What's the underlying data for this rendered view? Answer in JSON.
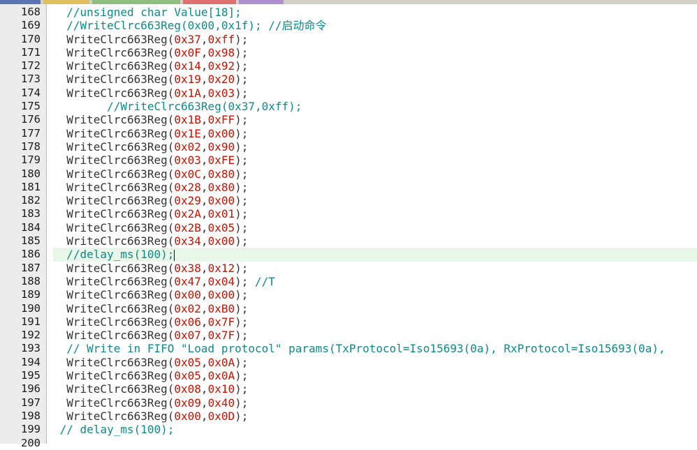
{
  "editor": {
    "tabs": [
      {
        "color": "#5b74b5"
      },
      {
        "color": "#e0c060"
      },
      {
        "color": "#8fbf7f"
      },
      {
        "color": "#e07070"
      },
      {
        "color": "#b090d0"
      }
    ],
    "current_line": 186,
    "lines": [
      {
        "num": "168",
        "indent": "  ",
        "segments": [
          {
            "t": "cmt",
            "v": "//unsigned char Value[18];"
          }
        ]
      },
      {
        "num": "169",
        "indent": "  ",
        "segments": [
          {
            "t": "cmt",
            "v": "//WriteClrc663Reg(0x00,0x1f); //启动命令"
          }
        ]
      },
      {
        "num": "170",
        "indent": "  ",
        "segments": [
          {
            "t": "fn",
            "v": "WriteClrc663Reg("
          },
          {
            "t": "hex",
            "v": "0x37"
          },
          {
            "t": "punc",
            "v": ","
          },
          {
            "t": "hex",
            "v": "0xff"
          },
          {
            "t": "punc",
            "v": ");"
          }
        ]
      },
      {
        "num": "171",
        "indent": "  ",
        "segments": [
          {
            "t": "fn",
            "v": "WriteClrc663Reg("
          },
          {
            "t": "hex",
            "v": "0x0F"
          },
          {
            "t": "punc",
            "v": ","
          },
          {
            "t": "hex",
            "v": "0x98"
          },
          {
            "t": "punc",
            "v": ");"
          }
        ]
      },
      {
        "num": "172",
        "indent": "  ",
        "segments": [
          {
            "t": "fn",
            "v": "WriteClrc663Reg("
          },
          {
            "t": "hex",
            "v": "0x14"
          },
          {
            "t": "punc",
            "v": ","
          },
          {
            "t": "hex",
            "v": "0x92"
          },
          {
            "t": "punc",
            "v": ");"
          }
        ]
      },
      {
        "num": "173",
        "indent": "  ",
        "segments": [
          {
            "t": "fn",
            "v": "WriteClrc663Reg("
          },
          {
            "t": "hex",
            "v": "0x19"
          },
          {
            "t": "punc",
            "v": ","
          },
          {
            "t": "hex",
            "v": "0x20"
          },
          {
            "t": "punc",
            "v": ");"
          }
        ]
      },
      {
        "num": "174",
        "indent": "  ",
        "segments": [
          {
            "t": "fn",
            "v": "WriteClrc663Reg("
          },
          {
            "t": "hex",
            "v": "0x1A"
          },
          {
            "t": "punc",
            "v": ","
          },
          {
            "t": "hex",
            "v": "0x03"
          },
          {
            "t": "punc",
            "v": ");"
          }
        ]
      },
      {
        "num": "175",
        "indent": "        ",
        "segments": [
          {
            "t": "cmt",
            "v": "//WriteClrc663Reg(0x37,0xff);"
          }
        ]
      },
      {
        "num": "176",
        "indent": "  ",
        "segments": [
          {
            "t": "fn",
            "v": "WriteClrc663Reg("
          },
          {
            "t": "hex",
            "v": "0x1B"
          },
          {
            "t": "punc",
            "v": ","
          },
          {
            "t": "hex",
            "v": "0xFF"
          },
          {
            "t": "punc",
            "v": ");"
          }
        ]
      },
      {
        "num": "177",
        "indent": "  ",
        "segments": [
          {
            "t": "fn",
            "v": "WriteClrc663Reg("
          },
          {
            "t": "hex",
            "v": "0x1E"
          },
          {
            "t": "punc",
            "v": ","
          },
          {
            "t": "hex",
            "v": "0x00"
          },
          {
            "t": "punc",
            "v": ");"
          }
        ]
      },
      {
        "num": "178",
        "indent": "  ",
        "segments": [
          {
            "t": "fn",
            "v": "WriteClrc663Reg("
          },
          {
            "t": "hex",
            "v": "0x02"
          },
          {
            "t": "punc",
            "v": ","
          },
          {
            "t": "hex",
            "v": "0x90"
          },
          {
            "t": "punc",
            "v": ");"
          }
        ]
      },
      {
        "num": "179",
        "indent": "  ",
        "segments": [
          {
            "t": "fn",
            "v": "WriteClrc663Reg("
          },
          {
            "t": "hex",
            "v": "0x03"
          },
          {
            "t": "punc",
            "v": ","
          },
          {
            "t": "hex",
            "v": "0xFE"
          },
          {
            "t": "punc",
            "v": ");"
          }
        ]
      },
      {
        "num": "180",
        "indent": "  ",
        "segments": [
          {
            "t": "fn",
            "v": "WriteClrc663Reg("
          },
          {
            "t": "hex",
            "v": "0x0C"
          },
          {
            "t": "punc",
            "v": ","
          },
          {
            "t": "hex",
            "v": "0x80"
          },
          {
            "t": "punc",
            "v": ");"
          }
        ]
      },
      {
        "num": "181",
        "indent": "  ",
        "segments": [
          {
            "t": "fn",
            "v": "WriteClrc663Reg("
          },
          {
            "t": "hex",
            "v": "0x28"
          },
          {
            "t": "punc",
            "v": ","
          },
          {
            "t": "hex",
            "v": "0x80"
          },
          {
            "t": "punc",
            "v": ");"
          }
        ]
      },
      {
        "num": "182",
        "indent": "  ",
        "segments": [
          {
            "t": "fn",
            "v": "WriteClrc663Reg("
          },
          {
            "t": "hex",
            "v": "0x29"
          },
          {
            "t": "punc",
            "v": ","
          },
          {
            "t": "hex",
            "v": "0x00"
          },
          {
            "t": "punc",
            "v": ");"
          }
        ]
      },
      {
        "num": "183",
        "indent": "  ",
        "segments": [
          {
            "t": "fn",
            "v": "WriteClrc663Reg("
          },
          {
            "t": "hex",
            "v": "0x2A"
          },
          {
            "t": "punc",
            "v": ","
          },
          {
            "t": "hex",
            "v": "0x01"
          },
          {
            "t": "punc",
            "v": ");"
          }
        ]
      },
      {
        "num": "184",
        "indent": "  ",
        "segments": [
          {
            "t": "fn",
            "v": "WriteClrc663Reg("
          },
          {
            "t": "hex",
            "v": "0x2B"
          },
          {
            "t": "punc",
            "v": ","
          },
          {
            "t": "hex",
            "v": "0x05"
          },
          {
            "t": "punc",
            "v": ");"
          }
        ]
      },
      {
        "num": "185",
        "indent": "  ",
        "segments": [
          {
            "t": "fn",
            "v": "WriteClrc663Reg("
          },
          {
            "t": "hex",
            "v": "0x34"
          },
          {
            "t": "punc",
            "v": ","
          },
          {
            "t": "hex",
            "v": "0x00"
          },
          {
            "t": "punc",
            "v": ");"
          }
        ]
      },
      {
        "num": "186",
        "indent": "  ",
        "segments": [
          {
            "t": "cmt",
            "v": "//delay_ms(100);"
          }
        ],
        "caret": true
      },
      {
        "num": "187",
        "indent": "  ",
        "segments": [
          {
            "t": "fn",
            "v": "WriteClrc663Reg("
          },
          {
            "t": "hex",
            "v": "0x38"
          },
          {
            "t": "punc",
            "v": ","
          },
          {
            "t": "hex",
            "v": "0x12"
          },
          {
            "t": "punc",
            "v": ");"
          }
        ]
      },
      {
        "num": "188",
        "indent": "  ",
        "segments": [
          {
            "t": "fn",
            "v": "WriteClrc663Reg("
          },
          {
            "t": "hex",
            "v": "0x47"
          },
          {
            "t": "punc",
            "v": ","
          },
          {
            "t": "hex",
            "v": "0x04"
          },
          {
            "t": "punc",
            "v": "); "
          },
          {
            "t": "cmt",
            "v": "//T"
          }
        ]
      },
      {
        "num": "189",
        "indent": "  ",
        "segments": [
          {
            "t": "fn",
            "v": "WriteClrc663Reg("
          },
          {
            "t": "hex",
            "v": "0x00"
          },
          {
            "t": "punc",
            "v": ","
          },
          {
            "t": "hex",
            "v": "0x00"
          },
          {
            "t": "punc",
            "v": ");"
          }
        ]
      },
      {
        "num": "190",
        "indent": "  ",
        "segments": [
          {
            "t": "fn",
            "v": "WriteClrc663Reg("
          },
          {
            "t": "hex",
            "v": "0x02"
          },
          {
            "t": "punc",
            "v": ","
          },
          {
            "t": "hex",
            "v": "0xB0"
          },
          {
            "t": "punc",
            "v": ");"
          }
        ]
      },
      {
        "num": "191",
        "indent": "  ",
        "segments": [
          {
            "t": "fn",
            "v": "WriteClrc663Reg("
          },
          {
            "t": "hex",
            "v": "0x06"
          },
          {
            "t": "punc",
            "v": ","
          },
          {
            "t": "hex",
            "v": "0x7F"
          },
          {
            "t": "punc",
            "v": ");"
          }
        ]
      },
      {
        "num": "192",
        "indent": "  ",
        "segments": [
          {
            "t": "fn",
            "v": "WriteClrc663Reg("
          },
          {
            "t": "hex",
            "v": "0x07"
          },
          {
            "t": "punc",
            "v": ","
          },
          {
            "t": "hex",
            "v": "0x7F"
          },
          {
            "t": "punc",
            "v": ");"
          }
        ]
      },
      {
        "num": "193",
        "indent": "  ",
        "segments": [
          {
            "t": "cmt",
            "v": "// Write in FIFO \"Load protocol\" params(TxProtocol=Iso15693(0a), RxProtocol=Iso15693(0a),"
          }
        ]
      },
      {
        "num": "194",
        "indent": "  ",
        "segments": [
          {
            "t": "fn",
            "v": "WriteClrc663Reg("
          },
          {
            "t": "hex",
            "v": "0x05"
          },
          {
            "t": "punc",
            "v": ","
          },
          {
            "t": "hex",
            "v": "0x0A"
          },
          {
            "t": "punc",
            "v": ");"
          }
        ]
      },
      {
        "num": "195",
        "indent": "  ",
        "segments": [
          {
            "t": "fn",
            "v": "WriteClrc663Reg("
          },
          {
            "t": "hex",
            "v": "0x05"
          },
          {
            "t": "punc",
            "v": ","
          },
          {
            "t": "hex",
            "v": "0x0A"
          },
          {
            "t": "punc",
            "v": ");"
          }
        ]
      },
      {
        "num": "196",
        "indent": "  ",
        "segments": [
          {
            "t": "fn",
            "v": "WriteClrc663Reg("
          },
          {
            "t": "hex",
            "v": "0x08"
          },
          {
            "t": "punc",
            "v": ","
          },
          {
            "t": "hex",
            "v": "0x10"
          },
          {
            "t": "punc",
            "v": ");"
          }
        ]
      },
      {
        "num": "197",
        "indent": "  ",
        "segments": [
          {
            "t": "fn",
            "v": "WriteClrc663Reg("
          },
          {
            "t": "hex",
            "v": "0x09"
          },
          {
            "t": "punc",
            "v": ","
          },
          {
            "t": "hex",
            "v": "0x40"
          },
          {
            "t": "punc",
            "v": ");"
          }
        ]
      },
      {
        "num": "198",
        "indent": "  ",
        "segments": [
          {
            "t": "fn",
            "v": "WriteClrc663Reg("
          },
          {
            "t": "hex",
            "v": "0x00"
          },
          {
            "t": "punc",
            "v": ","
          },
          {
            "t": "hex",
            "v": "0x0D"
          },
          {
            "t": "punc",
            "v": ");"
          }
        ]
      },
      {
        "num": "199",
        "indent": " ",
        "segments": [
          {
            "t": "cmt",
            "v": "// delay_ms(100);"
          }
        ]
      },
      {
        "num": "200",
        "indent": "",
        "segments": []
      }
    ]
  }
}
